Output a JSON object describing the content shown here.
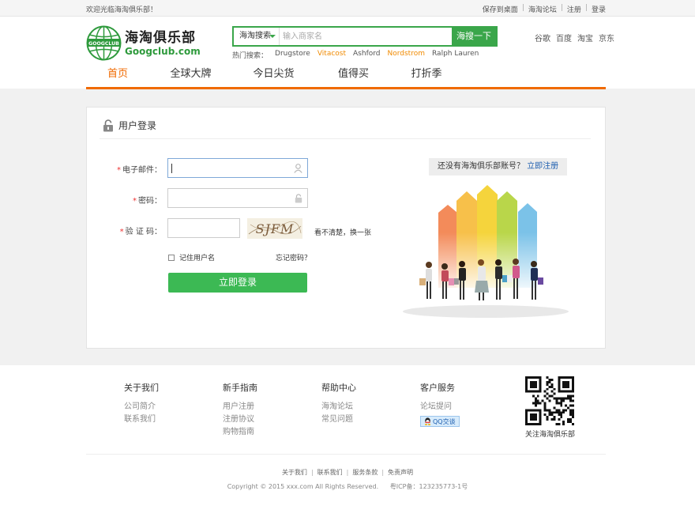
{
  "topbar": {
    "welcome": "欢迎光临海淘俱乐部！",
    "links": [
      "保存到桌面",
      "海淘论坛",
      "注册",
      "登录"
    ]
  },
  "logo": {
    "badge": "GOOGCLUB",
    "cn": "海淘俱乐部",
    "en": "Googclub.com"
  },
  "search": {
    "scope": "海淘搜索",
    "placeholder": "输入商家名",
    "button": "海搜一下",
    "hot_label": "热门搜索：",
    "hot": [
      {
        "text": "Drugstore",
        "highlight": false
      },
      {
        "text": "Vitacost",
        "highlight": true
      },
      {
        "text": "Ashford",
        "highlight": false
      },
      {
        "text": "Nordstrom",
        "highlight": true
      },
      {
        "text": "Ralph Lauren",
        "highlight": false
      }
    ]
  },
  "engines": [
    "谷歌",
    "百度",
    "淘宝",
    "京东"
  ],
  "nav": {
    "active": 0,
    "items": [
      "首页",
      "全球大牌",
      "今日尖货",
      "值得买",
      "打折季"
    ]
  },
  "login": {
    "title": "用户登录",
    "email_label": "电子邮件：",
    "password_label": "密码：",
    "captcha_label": "验 证 码：",
    "captcha_text": "SJFM",
    "captcha_refresh": "看不清楚，换一张",
    "remember": "记住用户名",
    "forgot": "忘记密码？",
    "submit": "立即登录",
    "register_prompt": "还没有海淘俱乐部账号？",
    "register_link": "立即注册"
  },
  "footer": {
    "columns": [
      {
        "head": "关于我们",
        "links": [
          "公司简介",
          "联系我们"
        ]
      },
      {
        "head": "新手指南",
        "links": [
          "用户注册",
          "注册协议",
          "购物指南"
        ]
      },
      {
        "head": "帮助中心",
        "links": [
          "海淘论坛",
          "常见问题"
        ]
      },
      {
        "head": "客户服务",
        "links": [
          "论坛提问"
        ],
        "qq": "QQ交谈"
      }
    ],
    "qr_label": "关注海淘俱乐部",
    "bottom_links": [
      "关于我们",
      "联系我们",
      "服务条款",
      "免责声明"
    ],
    "copyright": "Copyright © 2015 xxx.com All Rights Reserved.",
    "icp": "粤ICP备：123235773-1号"
  },
  "colors": {
    "brand_green": "#3aa64a",
    "nav_orange": "#f06a00",
    "link_blue": "#1f5fb0"
  }
}
